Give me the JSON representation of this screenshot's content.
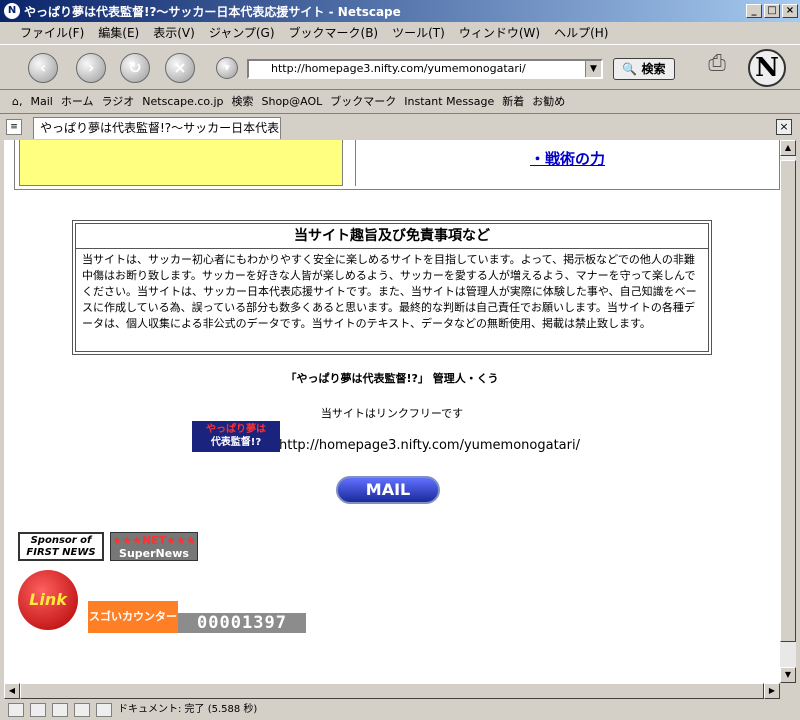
{
  "window": {
    "title": "やっぱり夢は代表監督!?～サッカー日本代表応援サイト - Netscape"
  },
  "menu": [
    "ファイル(F)",
    "編集(E)",
    "表示(V)",
    "ジャンプ(G)",
    "ブックマーク(B)",
    "ツール(T)",
    "ウィンドウ(W)",
    "ヘルプ(H)"
  ],
  "navigation": {
    "url": "http://homepage3.nifty.com/yumemonogatari/",
    "search_label": "検索"
  },
  "personal_toolbar": [
    "Mail",
    "ホーム",
    "ラジオ",
    "Netscape.co.jp",
    "検索",
    "Shop@AOL",
    "ブックマーク",
    "Instant Message",
    "新着",
    "お勧め"
  ],
  "tab": {
    "label": "やっぱり夢は代表監督!?～サッカー日本代表..."
  },
  "page": {
    "top_link": "・戦術の力",
    "disclaimer_title": "当サイト趣旨及び免責事項など",
    "disclaimer_text": "当サイトは、サッカー初心者にもわかりやすく安全に楽しめるサイトを目指しています。よって、掲示板などでの他人の非難中傷はお断り致します。サッカーを好きな人皆が楽しめるよう、サッカーを愛する人が増えるよう、マナーを守って楽しんでください。当サイトは、サッカー日本代表応援サイトです。また、当サイトは管理人が実際に体験した事や、自己知識をベースに作成している為、誤っている部分も数多くあると思います。最終的な判断は自己責任でお願いします。当サイトの各種データは、個人収集による非公式のデータです。当サイトのテキスト、データなどの無断使用、掲載は禁止致します。",
    "site_admin": "「やっぱり夢は代表監督!?」 管理人・くう",
    "link_free": "当サイトはリンクフリーです",
    "banner_line1": "やっぱり夢は",
    "banner_line2": "代表監督!?",
    "site_url": "http://homepage3.nifty.com/yumemonogatari/",
    "mail_button": "MAIL",
    "first_news_line1": "Sponsor of",
    "first_news_line2": "FIRST NEWS",
    "supernews_line1": "★★★NET★★★",
    "supernews_line2": "SuperNews",
    "link_ball": "Link",
    "counter_label": "スゴいカウンター",
    "counter_value": "00001397"
  },
  "status": {
    "text": "ドキュメント: 完了 (5.588 秒)"
  }
}
